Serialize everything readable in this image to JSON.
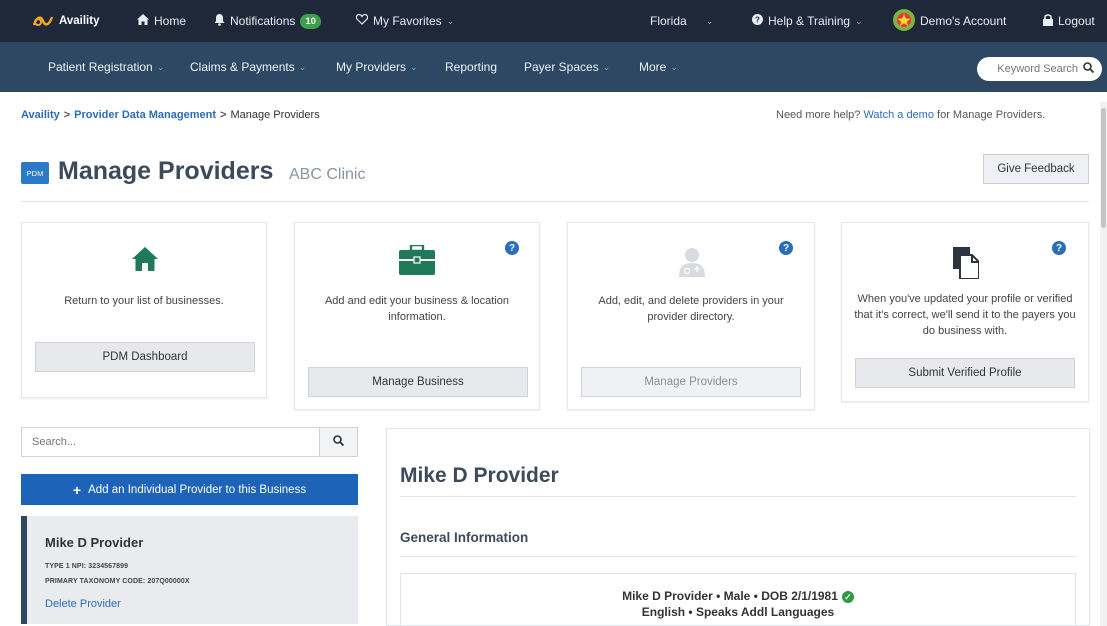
{
  "topbar": {
    "logo_text": "Availity",
    "home": "Home",
    "notifications": "Notifications",
    "notifications_count": "10",
    "favorites": "My Favorites",
    "state": "Florida",
    "help": "Help & Training",
    "account": "Demo's Account",
    "logout": "Logout"
  },
  "navbar": {
    "items": [
      "Patient Registration",
      "Claims & Payments",
      "My Providers",
      "Reporting",
      "Payer Spaces",
      "More"
    ],
    "search_placeholder": "Keyword Search"
  },
  "breadcrumb": {
    "root": "Availity",
    "section": "Provider Data Management",
    "current": "Manage Providers",
    "separator": ">"
  },
  "help_bar": {
    "prefix": "Need more help?",
    "link": "Watch a demo",
    "suffix": "for Manage Providers."
  },
  "page": {
    "icon_text": "PDM",
    "title": "Manage Providers",
    "subtitle": "ABC Clinic",
    "feedback": "Give Feedback"
  },
  "cards": [
    {
      "icon": "home-icon",
      "desc": "Return to your list of businesses.",
      "button": "PDM Dashboard",
      "help": false,
      "enabled": true
    },
    {
      "icon": "briefcase-icon",
      "desc": "Add and edit your business & location information.",
      "button": "Manage Business",
      "help": true,
      "enabled": true
    },
    {
      "icon": "user-doctor-icon",
      "desc": "Add, edit, and delete providers in your provider directory.",
      "button": "Manage Providers",
      "help": true,
      "enabled": false
    },
    {
      "icon": "document-copy-icon",
      "desc": "When you've updated your profile or verified that it's correct, we'll send it to the payers you do business with.",
      "button": "Submit Verified Profile",
      "help": true,
      "enabled": true
    }
  ],
  "sidebar": {
    "search_placeholder": "Search...",
    "add_button": "Add an Individual Provider to this Business",
    "provider": {
      "name": "Mike D Provider",
      "npi": "TYPE 1 NPI: 3234567899",
      "taxonomy": "PRIMARY TAXONOMY CODE: 207Q00000X",
      "delete": "Delete Provider"
    }
  },
  "detail": {
    "name": "Mike D Provider",
    "section": "General Information",
    "line1": "Mike D Provider • Male • DOB 2/1/1981",
    "line2": "English • Speaks Addl Languages"
  },
  "colors": {
    "topbar": "#1e2838",
    "navbar": "#2e4762",
    "link": "#2a6dba",
    "primary_button": "#1d63b8",
    "card_icon_green": "#1f7a5a",
    "badge_green": "#3aa04a"
  }
}
